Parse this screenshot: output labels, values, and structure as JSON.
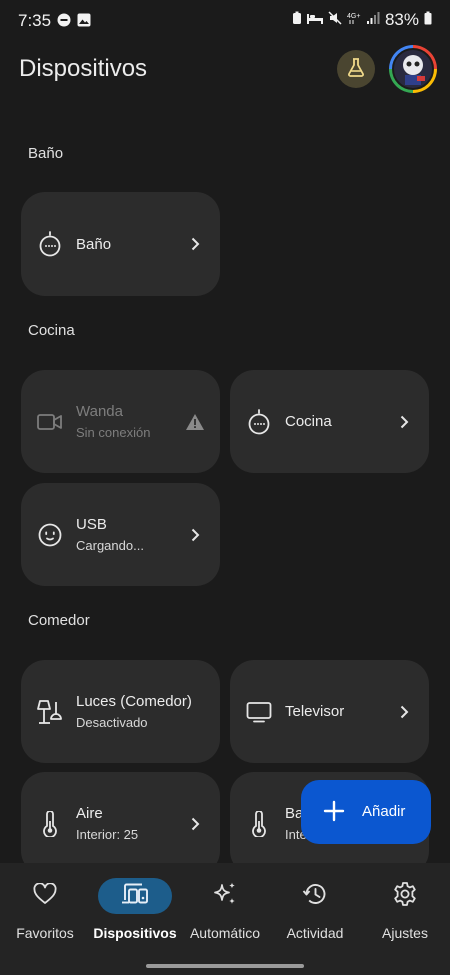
{
  "status_bar": {
    "time": "7:35",
    "battery": "83%"
  },
  "header": {
    "title": "Dispositivos"
  },
  "sections": {
    "bano": {
      "title": "Baño"
    },
    "cocina": {
      "title": "Cocina"
    },
    "comedor": {
      "title": "Comedor"
    }
  },
  "devices": {
    "bano_speaker": {
      "name": "Baño"
    },
    "wanda": {
      "name": "Wanda",
      "status": "Sin conexión"
    },
    "cocina_speaker": {
      "name": "Cocina"
    },
    "usb": {
      "name": "USB",
      "status": "Cargando..."
    },
    "luces": {
      "name": "Luces (Comedor)",
      "status": "Desactivado"
    },
    "televisor": {
      "name": "Televisor"
    },
    "aire": {
      "name": "Aire",
      "status": "Interior: 25"
    },
    "partial": {
      "name": "Ba",
      "status": "Inte"
    }
  },
  "fab": {
    "label": "Añadir"
  },
  "nav": {
    "favoritos": "Favoritos",
    "dispositivos": "Dispositivos",
    "automatico": "Automático",
    "actividad": "Actividad",
    "ajustes": "Ajustes"
  },
  "colors": {
    "background": "#1b1b1b",
    "card": "#2c2c2c",
    "accent": "#0b57d0",
    "nav_active": "#1d5d8b"
  }
}
